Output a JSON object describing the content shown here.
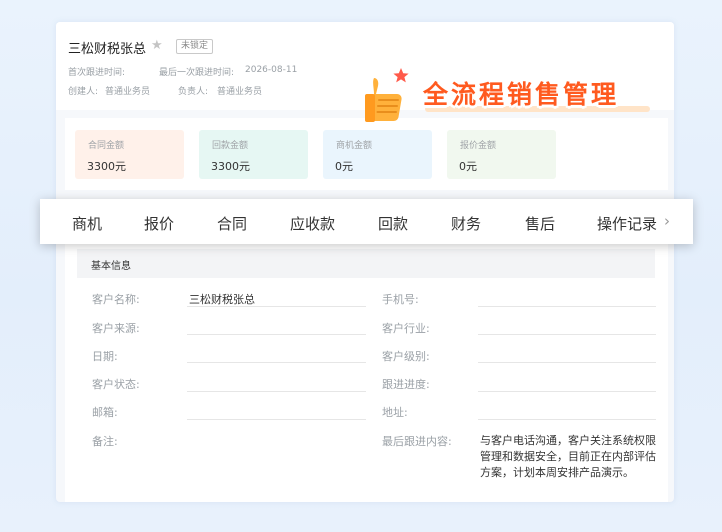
{
  "customer": {
    "name": "三松财税张总",
    "status_badge": "未锁定",
    "first_follow_label": "首次跟进时间:",
    "last_follow_label": "最后一次跟进时间:",
    "last_follow_value": "2026-08-11",
    "creator_label": "创建人:",
    "creator_value": "普通业务员",
    "owner_label": "负责人:",
    "owner_value": "普通业务员"
  },
  "promo": {
    "text": "全流程销售管理"
  },
  "amounts": [
    {
      "label": "合同金额",
      "value": "3300元",
      "bg": "#fff1ea"
    },
    {
      "label": "回款金额",
      "value": "3300元",
      "bg": "#e6f7f3"
    },
    {
      "label": "商机金额",
      "value": "0元",
      "bg": "#eaf5fd"
    },
    {
      "label": "报价金额",
      "value": "0元",
      "bg": "#f1f8ef"
    }
  ],
  "tabs": [
    "商机",
    "报价",
    "合同",
    "应收款",
    "回款",
    "财务",
    "售后",
    "操作记录"
  ],
  "section_title": "基本信息",
  "fields": {
    "name_label": "客户名称:",
    "name_value": "三松财税张总",
    "phone_label": "手机号:",
    "source_label": "客户来源:",
    "industry_label": "客户行业:",
    "date_label": "日期:",
    "level_label": "客户级别:",
    "status_label": "客户状态:",
    "progress_label": "跟进进度:",
    "email_label": "邮箱:",
    "address_label": "地址:",
    "remark_label": "备注:",
    "last_content_label": "最后跟进内容:",
    "last_content_value": "与客户电话沟通，客户关注系统权限管理和数据安全，目前正在内部评估方案，计划本周安排产品演示。"
  },
  "colors": {
    "promo_orange": "#ff5a1f",
    "background": "#e3eefb"
  },
  "icons": [
    "star-icon",
    "thumbs-up-icon",
    "chevron-right-icon"
  ]
}
